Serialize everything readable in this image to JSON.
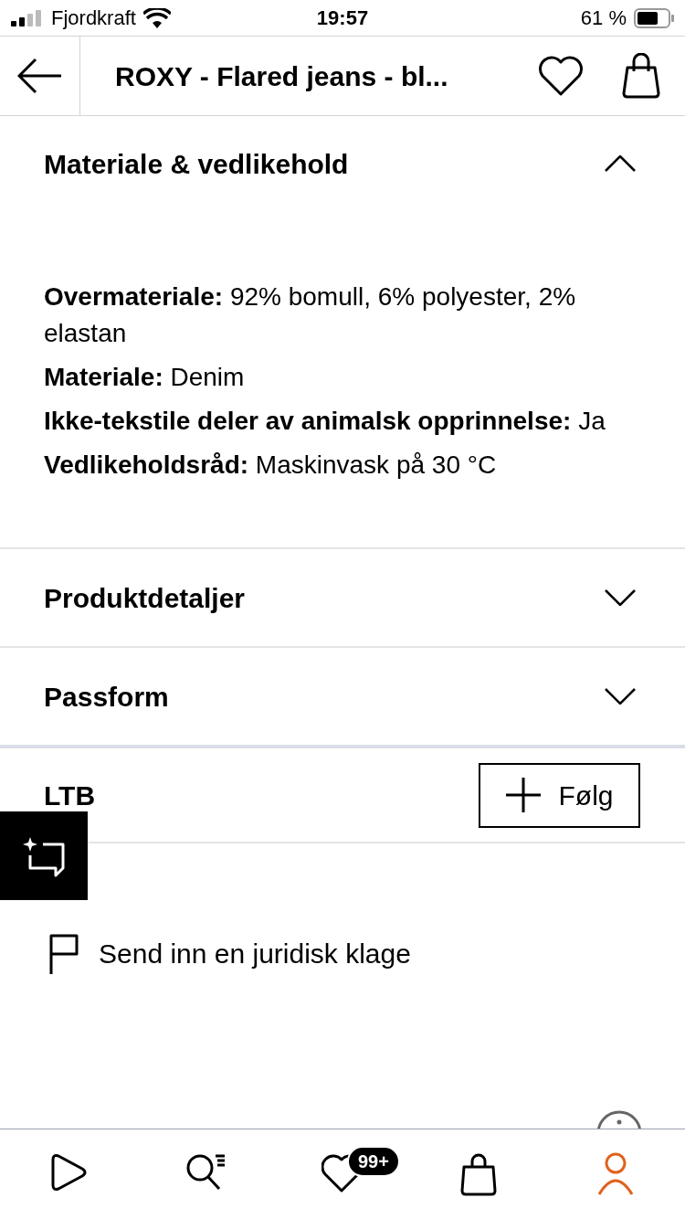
{
  "status_bar": {
    "carrier": "Fjordkraft",
    "time": "19:57",
    "battery": "61 %"
  },
  "header": {
    "title": "ROXY - Flared jeans - bl..."
  },
  "sections": [
    {
      "title": "Materiale & vedlikehold",
      "expanded": true,
      "lines": [
        "**Overmateriale:** 92% bomull, 6% polyester, 2% elastan",
        "**Materiale:** Denim",
        "**Ikke-tekstile deler av animalsk opprinnelse:** Ja",
        "**Vedlikeholdsråd:** Maskinvask på 30 °C"
      ]
    },
    {
      "title": "Produktdetaljer",
      "expanded": false
    },
    {
      "title": "Passform",
      "expanded": false
    }
  ],
  "brand": {
    "name": "LTB",
    "follow_button": "Følg"
  },
  "report_link": "Send inn en juridisk klage",
  "nav": [
    {
      "kind": "home",
      "selected": false
    },
    {
      "kind": "search",
      "selected": false
    },
    {
      "kind": "wishlist",
      "selected": false,
      "badge": "99+"
    },
    {
      "kind": "bag",
      "selected": false
    },
    {
      "kind": "profile",
      "selected": true
    }
  ]
}
